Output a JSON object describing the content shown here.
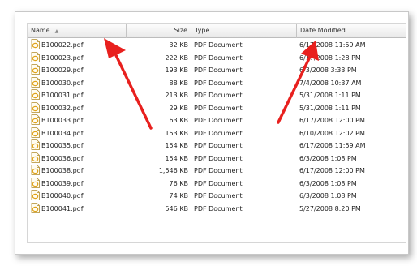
{
  "columns": {
    "name": "Name",
    "size": "Size",
    "type": "Type",
    "date": "Date Modified"
  },
  "files": [
    {
      "name": "B100022.pdf",
      "size": "32 KB",
      "type": "PDF Document",
      "date": "6/17/2008 11:59 AM"
    },
    {
      "name": "B100023.pdf",
      "size": "222 KB",
      "type": "PDF Document",
      "date": "6/17/2008 1:28 PM"
    },
    {
      "name": "B100029.pdf",
      "size": "193 KB",
      "type": "PDF Document",
      "date": "6/3/2008 3:33 PM"
    },
    {
      "name": "B100030.pdf",
      "size": "88 KB",
      "type": "PDF Document",
      "date": "7/4/2008 10:37 AM"
    },
    {
      "name": "B100031.pdf",
      "size": "213 KB",
      "type": "PDF Document",
      "date": "5/31/2008 1:11 PM"
    },
    {
      "name": "B100032.pdf",
      "size": "29 KB",
      "type": "PDF Document",
      "date": "5/31/2008 1:11 PM"
    },
    {
      "name": "B100033.pdf",
      "size": "63 KB",
      "type": "PDF Document",
      "date": "6/17/2008 12:00 PM"
    },
    {
      "name": "B100034.pdf",
      "size": "153 KB",
      "type": "PDF Document",
      "date": "6/10/2008 12:02 PM"
    },
    {
      "name": "B100035.pdf",
      "size": "154 KB",
      "type": "PDF Document",
      "date": "6/17/2008 11:59 AM"
    },
    {
      "name": "B100036.pdf",
      "size": "154 KB",
      "type": "PDF Document",
      "date": "6/3/2008 1:08 PM"
    },
    {
      "name": "B100038.pdf",
      "size": "1,546 KB",
      "type": "PDF Document",
      "date": "6/17/2008 12:00 PM"
    },
    {
      "name": "B100039.pdf",
      "size": "76 KB",
      "type": "PDF Document",
      "date": "6/3/2008 1:08 PM"
    },
    {
      "name": "B100040.pdf",
      "size": "74 KB",
      "type": "PDF Document",
      "date": "6/3/2008 1:08 PM"
    },
    {
      "name": "B100041.pdf",
      "size": "546 KB",
      "type": "PDF Document",
      "date": "5/27/2008 8:20 PM"
    }
  ],
  "icons": {
    "file": "pdf-file-icon",
    "sort": "sort-ascending-icon",
    "annotation": "red-arrow-icon"
  },
  "colors": {
    "arrow": "#e8201e",
    "header_bg": "#ececec",
    "text": "#222222"
  }
}
